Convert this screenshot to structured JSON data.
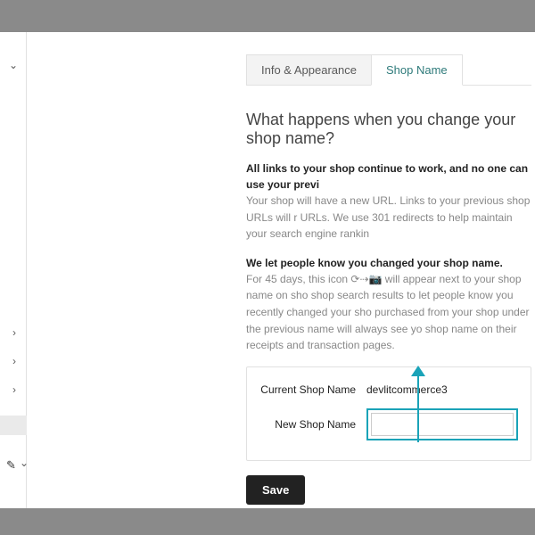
{
  "tabs": {
    "info": "Info & Appearance",
    "shop": "Shop Name"
  },
  "heading": "What happens when you change your shop name?",
  "block1": {
    "bold": "All links to your shop continue to work, and no one can use your previ",
    "text": "Your shop will have a new URL. Links to your previous shop URLs will r URLs. We use 301 redirects to help maintain your search engine rankin"
  },
  "block2": {
    "bold": "We let people know you changed your shop name.",
    "text": "For 45 days, this icon ⟳⇢📷 will appear next to your shop name on sho shop search results to let people know you recently changed your sho purchased from your shop under the previous name will always see yo shop name on their receipts and transaction pages."
  },
  "form": {
    "currentLabel": "Current Shop Name",
    "currentValue": "devlitcommerce3",
    "newLabel": "New Shop Name",
    "newValue": ""
  },
  "buttons": {
    "save": "Save"
  }
}
